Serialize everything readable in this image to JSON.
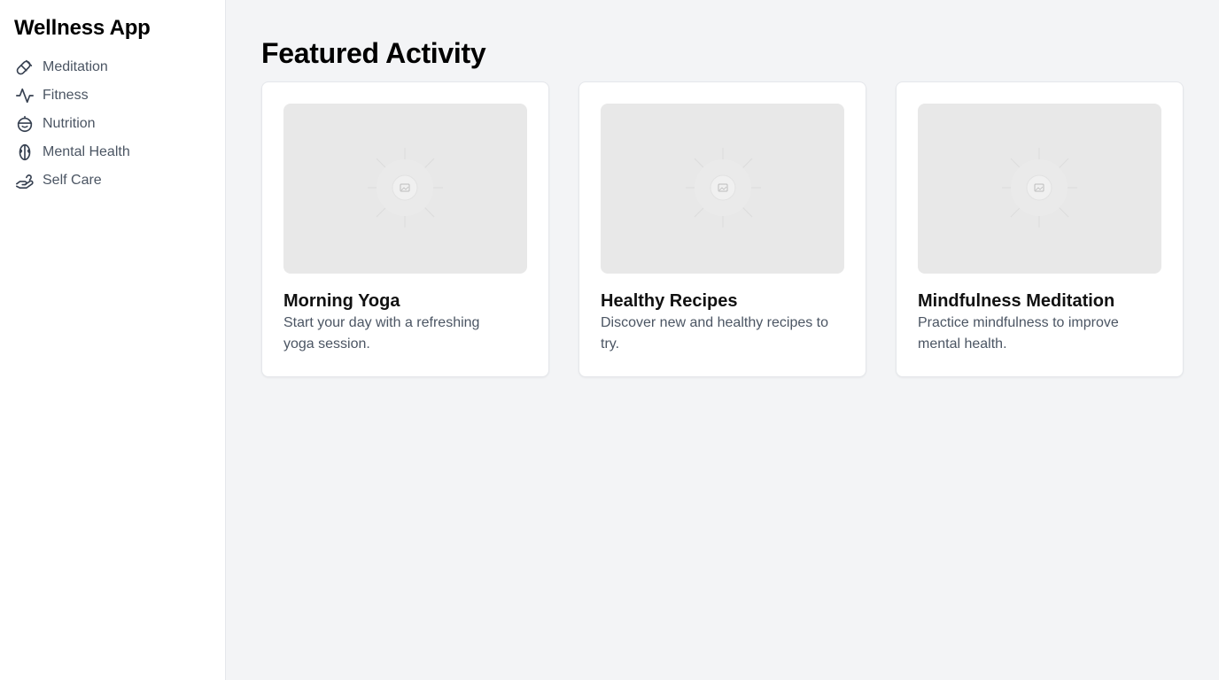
{
  "sidebar": {
    "title": "Wellness App",
    "items": [
      {
        "label": "Meditation",
        "icon": "meditation-icon"
      },
      {
        "label": "Fitness",
        "icon": "activity-icon"
      },
      {
        "label": "Nutrition",
        "icon": "nutrition-icon"
      },
      {
        "label": "Mental Health",
        "icon": "brain-icon"
      },
      {
        "label": "Self Care",
        "icon": "hand-heart-icon"
      }
    ]
  },
  "main": {
    "title": "Featured Activity",
    "cards": [
      {
        "title": "Morning Yoga",
        "description": "Start your day with a refreshing yoga session.",
        "image_icon": "image-placeholder-icon"
      },
      {
        "title": "Healthy Recipes",
        "description": "Discover new and healthy recipes to try.",
        "image_icon": "image-placeholder-icon"
      },
      {
        "title": "Mindfulness Meditation",
        "description": "Practice mindfulness to improve mental health.",
        "image_icon": "image-placeholder-icon"
      }
    ]
  },
  "colors": {
    "sidebar_bg": "#ffffff",
    "main_bg": "#f3f4f6",
    "text_muted": "#4b5563",
    "thumb_bg": "#e8e8e8"
  }
}
